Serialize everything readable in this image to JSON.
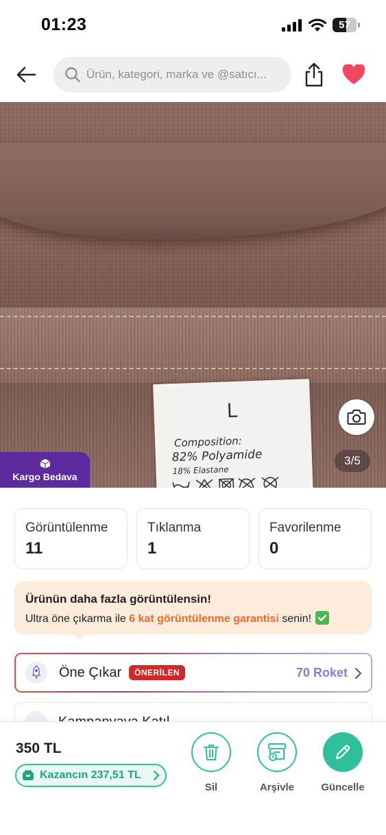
{
  "status_bar": {
    "time": "01:23",
    "battery_level": "57",
    "battery_fraction": 0.57
  },
  "header": {
    "back_icon": "back-arrow-icon",
    "search_placeholder": "Ürün, kategori, marka ve @satıcı...",
    "share_icon": "share-icon",
    "favorite_icon": "heart-icon"
  },
  "product_photo": {
    "label_size": "L",
    "label_composition": "Composition:",
    "label_polyamide": "82% Polyamide",
    "label_elastane": "18% Elastane",
    "photo_counter": "3/5",
    "shipping_badge": "Kargo Bedava",
    "camera_icon": "camera-icon"
  },
  "stats": [
    {
      "label": "Görüntülenme",
      "value": "11"
    },
    {
      "label": "Tıklanma",
      "value": "1"
    },
    {
      "label": "Favorilenme",
      "value": "0"
    }
  ],
  "promo": {
    "title": "Ürünün daha fazla görüntülensin!",
    "text_before": "Ultra öne çıkarma ile ",
    "highlight": "6 kat görüntülenme garantisi",
    "text_after": " senin!"
  },
  "boost": {
    "label": "Öne Çıkar",
    "badge": "ÖNERİLEN",
    "price": "70 Roket"
  },
  "campaign": {
    "label": "Kampanyaya Katıl"
  },
  "bottom_bar": {
    "price": "350 TL",
    "earnings": "Kazancın 237,51 TL",
    "actions": [
      {
        "label": "Sil",
        "icon": "trash-icon"
      },
      {
        "label": "Arşivle",
        "icon": "archive-icon"
      },
      {
        "label": "Güncelle",
        "icon": "pencil-icon"
      }
    ]
  },
  "colors": {
    "accent_green": "#2fbf9a",
    "accent_purple": "#5b2a9e",
    "promo_orange": "#f2692b",
    "heart_red": "#f2465f",
    "badge_red": "#cf2a27",
    "roket_purple": "#8a7bd6"
  }
}
